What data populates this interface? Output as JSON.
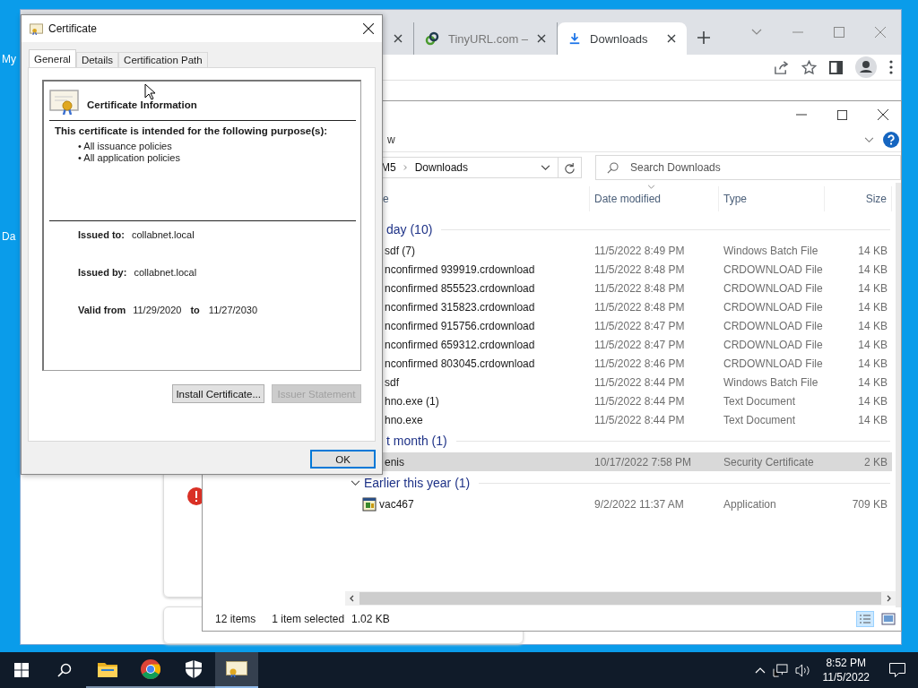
{
  "desktop": {
    "icon_labels": [
      "My",
      "Da"
    ]
  },
  "browser": {
    "tabs": [
      {
        "kind": "blank",
        "selected": false
      },
      {
        "kind": "link",
        "title": "TinyURL.com –",
        "selected": false
      },
      {
        "kind": "download",
        "title": "Downloads",
        "selected": true
      }
    ]
  },
  "explorer": {
    "menu_fragment": "w",
    "path_fragment": "M5",
    "path": "Downloads",
    "search_placeholder": "Search Downloads",
    "columns": [
      {
        "label": "e",
        "sorted": false
      },
      {
        "label": "Date modified",
        "sorted": true
      },
      {
        "label": "Type",
        "sorted": false
      },
      {
        "label": "Size",
        "sorted": false
      }
    ],
    "groups": [
      {
        "label": "day (10)",
        "covered": true,
        "files": [
          {
            "name": "sdf (7)",
            "date": "11/5/2022 8:49 PM",
            "type": "Windows Batch File",
            "size": "14 KB",
            "selected": false,
            "covered": true
          },
          {
            "name": "nconfirmed 939919.crdownload",
            "date": "11/5/2022 8:48 PM",
            "type": "CRDOWNLOAD File",
            "size": "14 KB",
            "selected": false,
            "covered": true
          },
          {
            "name": "nconfirmed 855523.crdownload",
            "date": "11/5/2022 8:48 PM",
            "type": "CRDOWNLOAD File",
            "size": "14 KB",
            "selected": false,
            "covered": true
          },
          {
            "name": "nconfirmed 315823.crdownload",
            "date": "11/5/2022 8:48 PM",
            "type": "CRDOWNLOAD File",
            "size": "14 KB",
            "selected": false,
            "covered": true
          },
          {
            "name": "nconfirmed 915756.crdownload",
            "date": "11/5/2022 8:47 PM",
            "type": "CRDOWNLOAD File",
            "size": "14 KB",
            "selected": false,
            "covered": true
          },
          {
            "name": "nconfirmed 659312.crdownload",
            "date": "11/5/2022 8:47 PM",
            "type": "CRDOWNLOAD File",
            "size": "14 KB",
            "selected": false,
            "covered": true
          },
          {
            "name": "nconfirmed 803045.crdownload",
            "date": "11/5/2022 8:46 PM",
            "type": "CRDOWNLOAD File",
            "size": "14 KB",
            "selected": false,
            "covered": true
          },
          {
            "name": "sdf",
            "date": "11/5/2022 8:44 PM",
            "type": "Windows Batch File",
            "size": "14 KB",
            "selected": false,
            "covered": true
          },
          {
            "name": "hno.exe (1)",
            "date": "11/5/2022 8:44 PM",
            "type": "Text Document",
            "size": "14 KB",
            "selected": false,
            "covered": true
          },
          {
            "name": "hno.exe",
            "date": "11/5/2022 8:44 PM",
            "type": "Text Document",
            "size": "14 KB",
            "selected": false,
            "covered": true
          }
        ]
      },
      {
        "label": "t month (1)",
        "covered": true,
        "files": [
          {
            "name": "enis",
            "date": "10/17/2022 7:58 PM",
            "type": "Security Certificate",
            "size": "2 KB",
            "selected": true,
            "covered": true
          }
        ]
      },
      {
        "label": "Earlier this year (1)",
        "covered": false,
        "expanded": true,
        "files": [
          {
            "name": "vac467",
            "date": "9/2/2022 11:37 AM",
            "type": "Application",
            "size": "709 KB",
            "selected": false,
            "covered": false
          }
        ]
      }
    ],
    "status": {
      "count": "12 items",
      "selection": "1 item selected",
      "size": "1.02 KB"
    }
  },
  "certificate": {
    "title": "Certificate",
    "tabs": [
      {
        "label": "General",
        "selected": true
      },
      {
        "label": "Details",
        "selected": false
      },
      {
        "label": "Certification Path",
        "selected": false
      }
    ],
    "heading": "Certificate Information",
    "purpose_heading": "This certificate is intended for the following purpose(s):",
    "purposes": [
      "• All issuance policies",
      "• All application policies"
    ],
    "fields": [
      {
        "label": "Issued to:",
        "value": "collabnet.local"
      },
      {
        "label": "Issued by:",
        "value": "collabnet.local"
      }
    ],
    "validity": {
      "label": "Valid from",
      "from": "11/29/2020",
      "to_label": "to",
      "to": "11/27/2030"
    },
    "buttons": [
      {
        "label": "Install Certificate...",
        "disabled": false
      },
      {
        "label": "Issuer Statement",
        "disabled": true
      }
    ],
    "ok": {
      "label": "OK",
      "default": true
    }
  },
  "taskbar": {
    "apps": [
      {
        "kind": "folder",
        "active": false
      },
      {
        "kind": "browser",
        "active": false
      },
      {
        "kind": "shield",
        "active": false
      },
      {
        "kind": "certificate",
        "active": true
      }
    ],
    "time": "8:52 PM",
    "date": "11/5/2022"
  }
}
